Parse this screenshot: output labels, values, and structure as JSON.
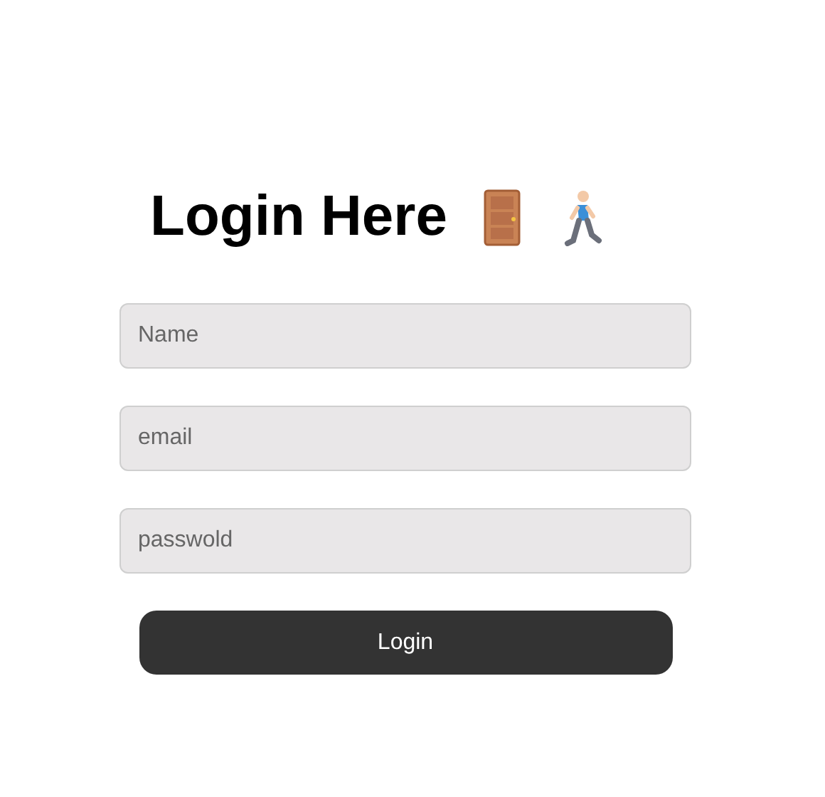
{
  "title": "Login Here",
  "fields": [
    {
      "placeholder": "Name"
    },
    {
      "placeholder": "email"
    },
    {
      "placeholder": "passwold"
    }
  ],
  "button": "Login"
}
